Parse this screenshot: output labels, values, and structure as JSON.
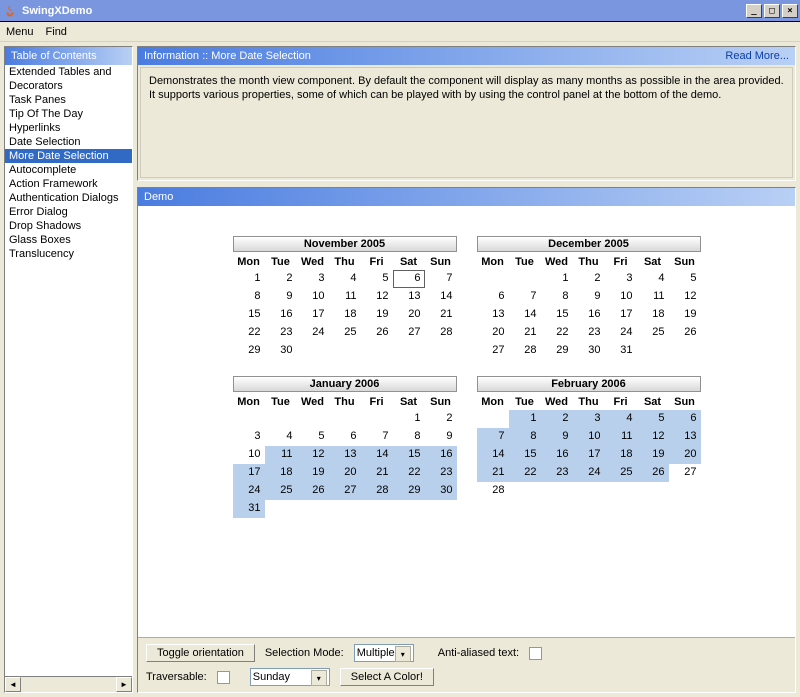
{
  "window": {
    "title": "SwingXDemo"
  },
  "menu": {
    "menu": "Menu",
    "find": "Find"
  },
  "sidebar": {
    "header": "Table of Contents",
    "items": [
      "Extended Tables and",
      "Decorators",
      "Task Panes",
      "Tip Of The Day",
      "Hyperlinks",
      "Date Selection",
      "More Date Selection",
      "Autocomplete",
      "Action Framework",
      "Authentication Dialogs",
      "Error Dialog",
      "Drop Shadows",
      "Glass Boxes",
      "Translucency"
    ],
    "selected_index": 6
  },
  "info": {
    "header": "Information :: More Date Selection",
    "readmore": "Read More...",
    "body": "Demonstrates the month view component. By default the component will display as many months as possible in the area provided. It supports various properties, some of which can be played with by using the control panel at the bottom of the demo."
  },
  "demo": {
    "header": "Demo",
    "dow": [
      "Mon",
      "Tue",
      "Wed",
      "Thu",
      "Fri",
      "Sat",
      "Sun"
    ],
    "months": [
      {
        "title": "November 2005",
        "first_dow": 1,
        "days": 30,
        "today": 6
      },
      {
        "title": "December 2005",
        "first_dow": 3,
        "days": 31
      },
      {
        "title": "January 2006",
        "first_dow": 6,
        "days": 31,
        "sel_from": 11,
        "sel_to": 31
      },
      {
        "title": "February 2006",
        "first_dow": 2,
        "days": 28,
        "sel_from": 1,
        "sel_to": 26
      }
    ],
    "controls": {
      "toggle": "Toggle orientation",
      "sel_mode_label": "Selection Mode:",
      "sel_mode_value": "Multiple",
      "aa_label": "Anti-aliased text:",
      "trav_label": "Traversable:",
      "first_dow_value": "Sunday",
      "color_btn": "Select A Color!"
    }
  }
}
